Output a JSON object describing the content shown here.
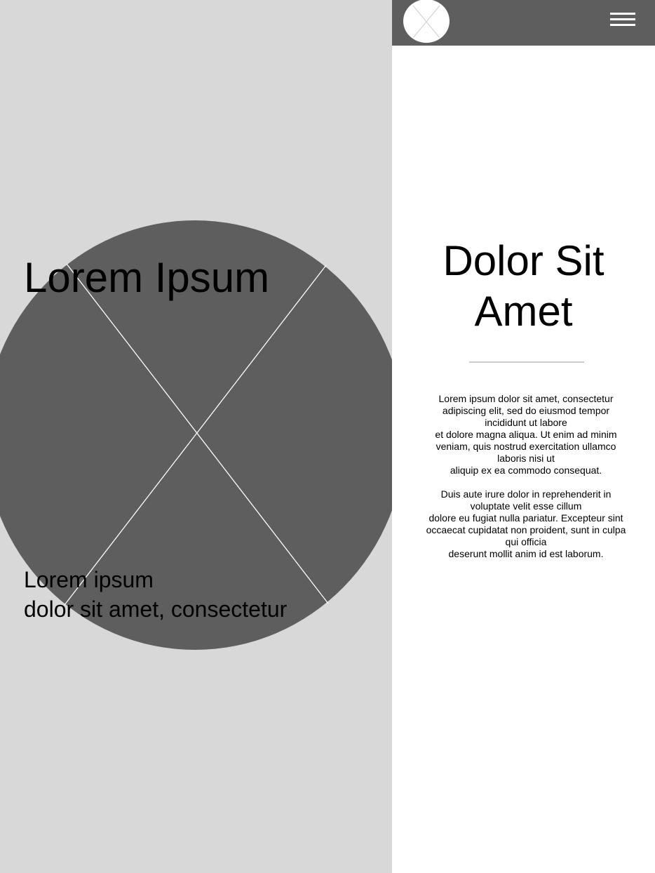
{
  "hero": {
    "title": "Lorem Ipsum",
    "caption_line1": "Lorem ipsum",
    "caption_line2": "dolor sit amet, consectetur",
    "image_icon": "image-placeholder-icon"
  },
  "header": {
    "logo_icon": "logo-placeholder-icon",
    "menu_icon": "hamburger-menu-icon"
  },
  "content": {
    "title_line1": "Dolor Sit",
    "title_line2": "Amet",
    "paragraph1": [
      "Lorem ipsum dolor sit amet, consectetur",
      "adipiscing elit, sed do eiusmod tempor",
      "incididunt ut labore",
      "et dolore magna aliqua. Ut enim ad minim",
      "veniam, quis nostrud exercitation ullamco",
      "laboris nisi ut",
      "aliquip ex ea commodo consequat."
    ],
    "paragraph2": [
      "Duis aute irure dolor in reprehenderit in",
      "voluptate velit esse cillum",
      "dolore eu fugiat nulla pariatur. Excepteur sint",
      "occaecat cupidatat non proident, sunt in culpa",
      "qui officia",
      "deserunt mollit anim id est laborum."
    ]
  },
  "colors": {
    "hero_background": "#d8d8d8",
    "placeholder_fill": "#5e5e5e",
    "header_background": "#5e5e5e",
    "divider": "#cccccc"
  }
}
